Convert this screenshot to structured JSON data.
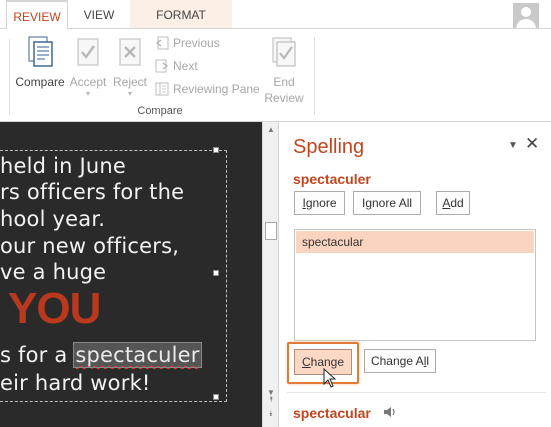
{
  "tabs": {
    "review": "REVIEW",
    "view": "VIEW",
    "format": "FORMAT"
  },
  "ribbon": {
    "compare_label": "Compare",
    "accept_label": "Accept",
    "reject_label": "Reject",
    "previous_label": "Previous",
    "next_label": "Next",
    "reviewing_pane_label": "Reviewing Pane",
    "end_review_line1": "End",
    "end_review_line2": "Review",
    "group_label": "Compare"
  },
  "slide": {
    "line1": "held in June",
    "line2": "rs officers for the",
    "line3": "hool year.",
    "line4": "our new officers,",
    "line5": "ve a huge",
    "line6": "YOU",
    "line7_prefix": "s for a ",
    "line7_word": "spectaculer",
    "line8": "eir hard work!"
  },
  "spelling_pane": {
    "title": "Spelling",
    "misspelled_word": "spectaculer",
    "ignore_label_u": "I",
    "ignore_label_rest": "gnore",
    "ignore_all_label_pre": "I",
    "ignore_all_label_u": "g",
    "ignore_all_label_rest": "nore All",
    "add_label_u": "A",
    "add_label_rest": "dd",
    "suggestions": [
      "spectacular"
    ],
    "change_label_u": "C",
    "change_label_rest": "hange",
    "change_all_label_pre": "Change A",
    "change_all_label_u": "l",
    "change_all_label_rest": "l",
    "dictionary_word": "spectacular"
  },
  "colors": {
    "accent": "#c1461e",
    "slide_bg": "#2a2a2a",
    "selected_suggestion": "#fbd4c0",
    "highlight_outline": "#e07b39"
  }
}
